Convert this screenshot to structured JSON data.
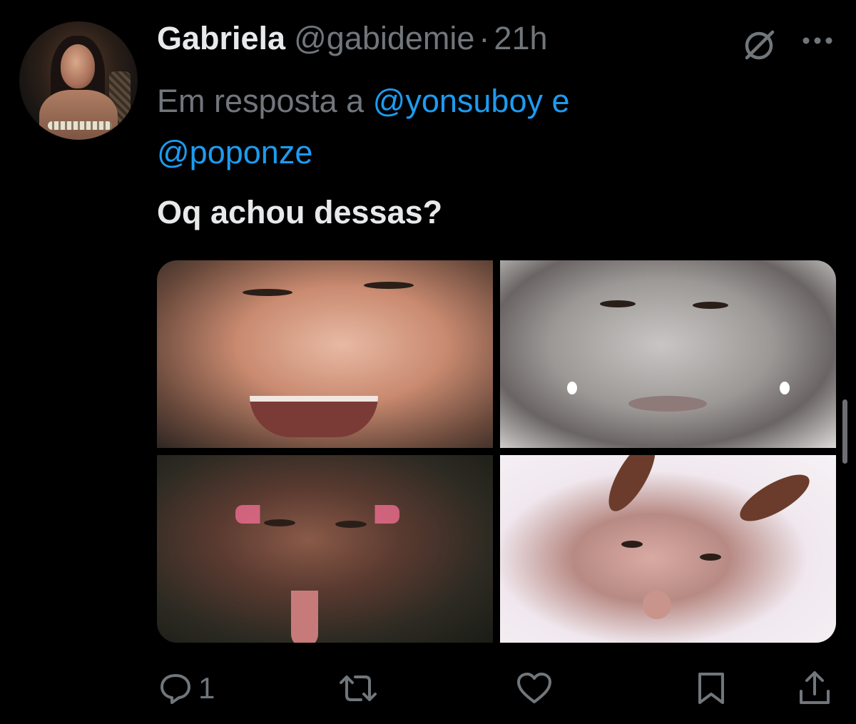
{
  "tweet": {
    "author_name": "Gabriela",
    "author_handle": "@gabidemie",
    "separator": "·",
    "timestamp": "21h",
    "reply_prefix": "Em resposta a",
    "reply_mentions": [
      "@yonsuboy",
      "@poponze"
    ],
    "reply_joiner": "e",
    "text": "Oq achou dessas?",
    "media_count": 4
  },
  "actions": {
    "reply_count": "1"
  },
  "icons": {
    "grok": "grok-icon",
    "more": "more-icon",
    "reply": "reply-icon",
    "retweet": "retweet-icon",
    "like": "heart-icon",
    "bookmark": "bookmark-icon",
    "share": "share-icon"
  },
  "colors": {
    "background": "#000000",
    "primary_text": "#e7e9ea",
    "secondary_text": "#71767b",
    "mention": "#1d9bf0"
  }
}
